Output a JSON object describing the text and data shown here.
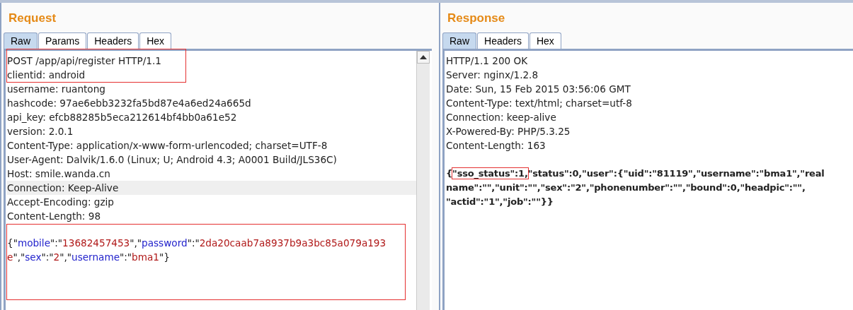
{
  "request": {
    "title": "Request",
    "tabs": [
      {
        "label": "Raw",
        "selected": true
      },
      {
        "label": "Params",
        "selected": false
      },
      {
        "label": "Headers",
        "selected": false
      },
      {
        "label": "Hex",
        "selected": false
      }
    ],
    "sections": [
      {
        "boxed": true,
        "lines": [
          {
            "text": "POST /app/api/register HTTP/1.1",
            "highlighted": false
          },
          {
            "text": "clientid: android",
            "highlighted": false
          }
        ]
      },
      {
        "boxed": false,
        "lines": [
          {
            "text": "username: ruantong",
            "highlighted": false
          },
          {
            "text": "hashcode: 97ae6ebb3232fa5bd87e4a6ed24a665d",
            "highlighted": false
          },
          {
            "text": "api_key: efcb88285b5eca212614bf4bb0a61e52",
            "highlighted": false
          },
          {
            "text": "version: 2.0.1",
            "highlighted": false
          },
          {
            "text": "Content-Type: application/x-www-form-urlencoded; charset=UTF-8",
            "highlighted": false
          },
          {
            "text": "User-Agent: Dalvik/1.6.0 (Linux; U; Android 4.3; A0001 Build/JLS36C)",
            "highlighted": false
          },
          {
            "text": "Host: smile.wanda.cn",
            "highlighted": false
          },
          {
            "text": "Connection: Keep-Alive",
            "highlighted": true
          },
          {
            "text": "Accept-Encoding: gzip",
            "highlighted": false
          },
          {
            "text": "Content-Length: 98",
            "highlighted": false
          }
        ]
      }
    ],
    "body": {
      "boxed": true,
      "lines": [
        [
          {
            "kind": "punct",
            "text": "{\""
          },
          {
            "kind": "key",
            "text": "mobile"
          },
          {
            "kind": "punct",
            "text": "\":\""
          },
          {
            "kind": "value",
            "text": "13682457453"
          },
          {
            "kind": "punct",
            "text": "\",\""
          },
          {
            "kind": "key",
            "text": "password"
          },
          {
            "kind": "punct",
            "text": "\":\""
          },
          {
            "kind": "value",
            "text": "2da20caab7a8937b9a3bc85a079a193"
          }
        ],
        [
          {
            "kind": "value",
            "text": "e"
          },
          {
            "kind": "punct",
            "text": "\",\""
          },
          {
            "kind": "key",
            "text": "sex"
          },
          {
            "kind": "punct",
            "text": "\":\""
          },
          {
            "kind": "value",
            "text": "2"
          },
          {
            "kind": "punct",
            "text": "\",\""
          },
          {
            "kind": "key",
            "text": "username"
          },
          {
            "kind": "punct",
            "text": "\":\""
          },
          {
            "kind": "value",
            "text": "bma1"
          },
          {
            "kind": "punct",
            "text": "\"}"
          }
        ]
      ]
    }
  },
  "response": {
    "title": "Response",
    "tabs": [
      {
        "label": "Raw",
        "selected": true
      },
      {
        "label": "Headers",
        "selected": false
      },
      {
        "label": "Hex",
        "selected": false
      }
    ],
    "lines": [
      "HTTP/1.1 200 OK",
      "Server: nginx/1.2.8",
      "Date: Sun, 15 Feb 2015 03:56:06 GMT",
      "Content-Type: text/html; charset=utf-8",
      "Connection: keep-alive",
      "X-Powered-By: PHP/5.3.25",
      "Content-Length: 163"
    ],
    "body": [
      [
        {
          "text": "{",
          "boxed": false
        },
        {
          "text": "\"sso_status\":1,",
          "boxed": true
        },
        {
          "text": "\"status\":0,\"user\":{\"uid\":\"81119\",\"username\":\"bma1\",\"real",
          "boxed": false
        }
      ],
      [
        {
          "text": "name\":\"\",\"unit\":\"\",\"sex\":\"2\",\"phonenumber\":\"\",\"bound\":0,\"headpic\":\"\",",
          "boxed": false
        }
      ],
      [
        {
          "text": "\"actid\":\"1\",\"job\":\"\"}}",
          "boxed": false
        }
      ]
    ]
  }
}
